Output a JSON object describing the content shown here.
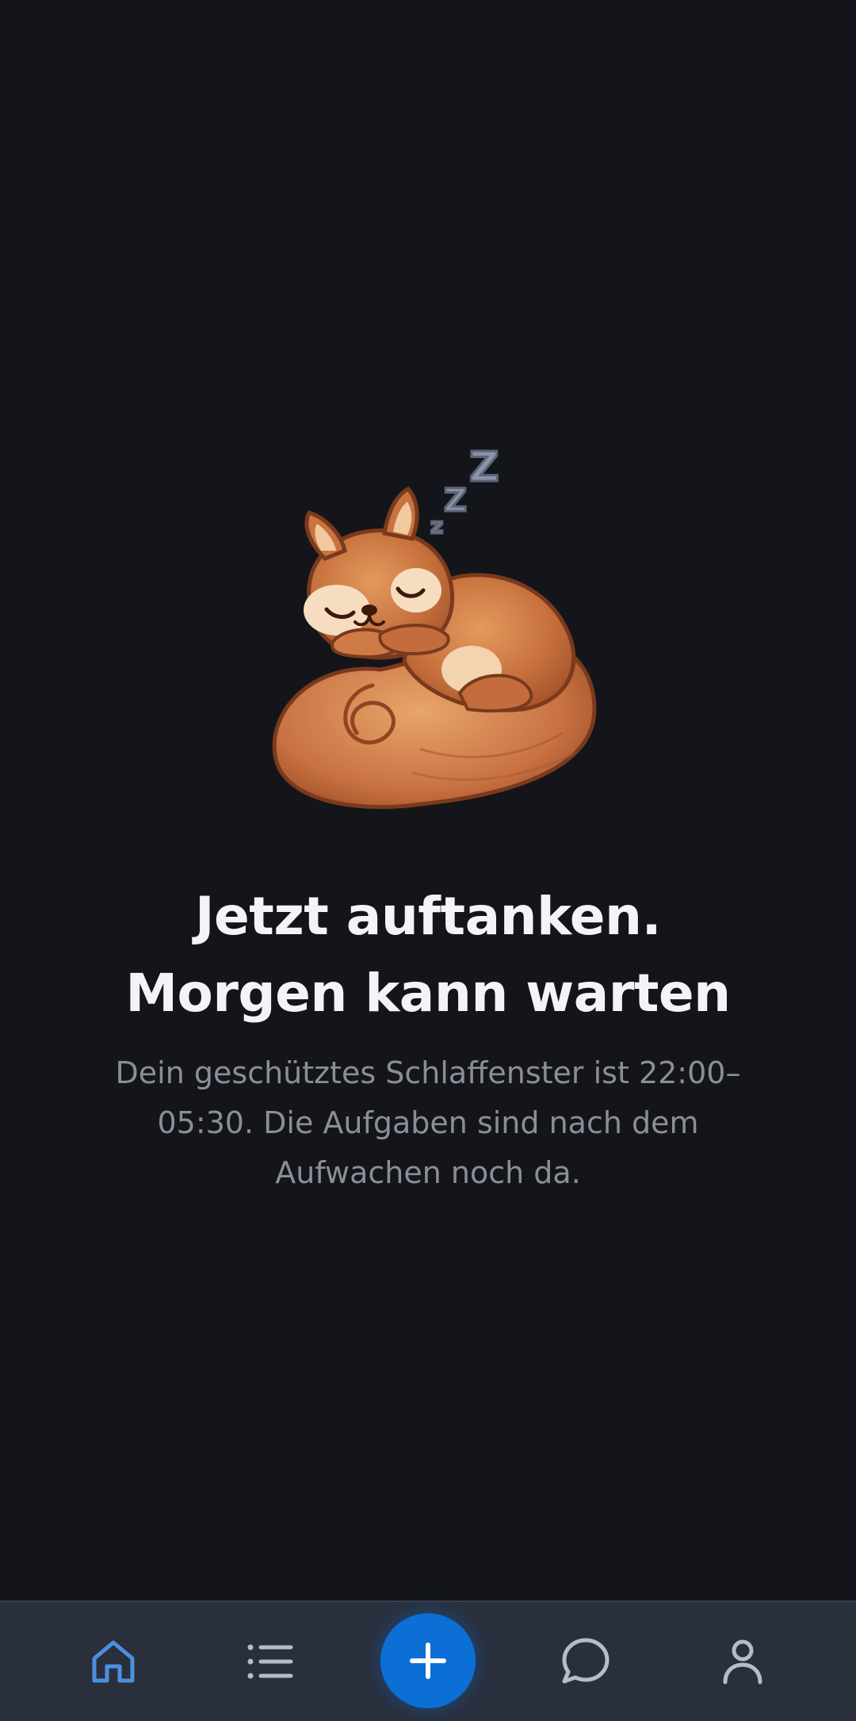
{
  "message": {
    "headline_line1": "Jetzt auftanken.",
    "headline_line2": "Morgen kann warten",
    "body": "Dein geschütztes Schlaffenster ist 22:00–05:30. Die Aufgaben sind nach dem Aufwachen noch da."
  },
  "illustration": {
    "name": "sleeping-squirrel",
    "sleep_symbols": [
      "z",
      "Z",
      "Z"
    ]
  },
  "nav": {
    "items": [
      {
        "icon": "home-icon",
        "active": true
      },
      {
        "icon": "list-icon",
        "active": false
      },
      {
        "icon": "plus-icon",
        "primary": true
      },
      {
        "icon": "chat-icon",
        "active": false
      },
      {
        "icon": "profile-icon",
        "active": false
      }
    ]
  },
  "colors": {
    "background": "#14151a",
    "nav_background": "#2a2f3c",
    "accent": "#0b6fd6",
    "active_icon": "#4a90e2",
    "inactive_icon": "#b7bcc6",
    "headline": "#f3f4f7",
    "body_text": "#8b8e96"
  }
}
